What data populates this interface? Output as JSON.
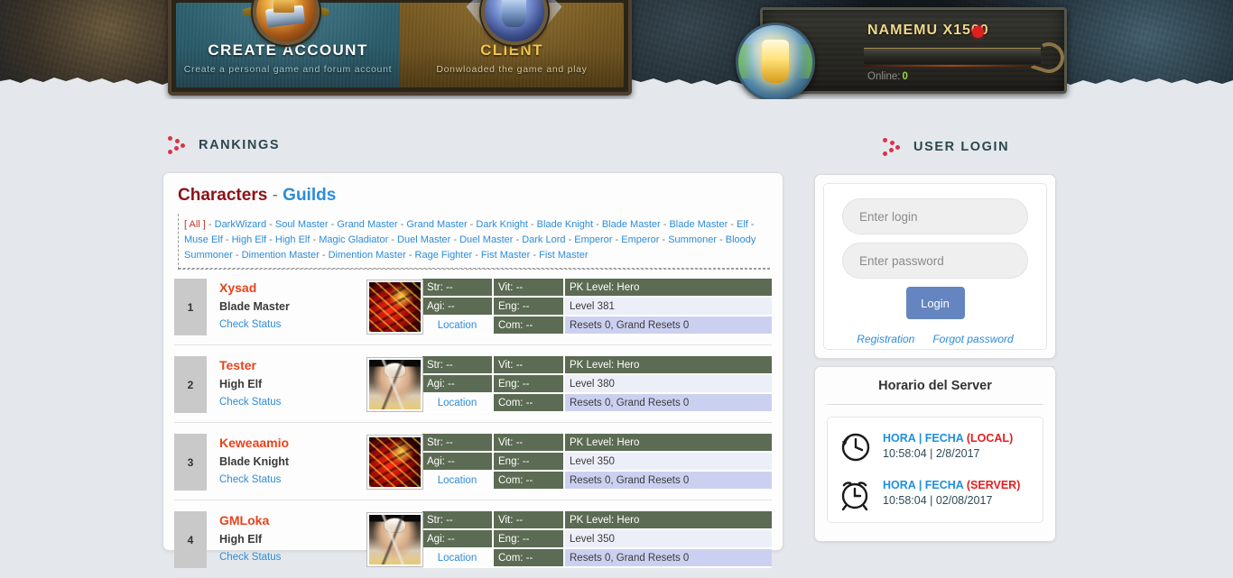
{
  "header": {
    "nav": [
      {
        "title": "CREATE ACCOUNT",
        "subtitle": "Create a personal game and forum account",
        "icon": "book-medal-icon"
      },
      {
        "title": "CLIENT",
        "subtitle": "Donwloaded the game and play",
        "icon": "armor-medal-icon"
      }
    ],
    "server": {
      "name": "NAMEMU X1500",
      "status_color": "#e02020",
      "online_label": "Online:",
      "online_count": "0"
    }
  },
  "rankings": {
    "section_title": "RANKINGS",
    "tabs": {
      "characters": "Characters",
      "separator": "-",
      "guilds": "Guilds"
    },
    "class_filters": [
      "[ All ]",
      "DarkWizard",
      "Soul Master",
      "Grand Master",
      "Grand Master",
      "Dark Knight",
      "Blade Knight",
      "Blade Master",
      "Blade Master",
      "Elf",
      "Muse Elf",
      "High Elf",
      "High Elf",
      "Magic Gladiator",
      "Duel Master",
      "Duel Master",
      "Dark Lord",
      "Emperor",
      "Emperor",
      "Summoner",
      "Bloody Summoner",
      "Dimention Master",
      "Dimention Master",
      "Rage Fighter",
      "Fist Master",
      "Fist Master"
    ],
    "status_link": "Check Status",
    "location_link": "Location",
    "rows": [
      {
        "rank": "1",
        "name": "Xysad",
        "class": "Blade Master",
        "portrait": "bm",
        "str": "Str: --",
        "vit": "Vit: --",
        "agi": "Agi: --",
        "eng": "Eng: --",
        "com": "Com: --",
        "pk": "PK Level: Hero",
        "level": "Level 381",
        "resets": "Resets 0, Grand Resets 0"
      },
      {
        "rank": "2",
        "name": "Tester",
        "class": "High Elf",
        "portrait": "he",
        "str": "Str: --",
        "vit": "Vit: --",
        "agi": "Agi: --",
        "eng": "Eng: --",
        "com": "Com: --",
        "pk": "PK Level: Hero",
        "level": "Level 380",
        "resets": "Resets 0, Grand Resets 0"
      },
      {
        "rank": "3",
        "name": "Keweaamio",
        "class": "Blade Knight",
        "portrait": "bm",
        "str": "Str: --",
        "vit": "Vit: --",
        "agi": "Agi: --",
        "eng": "Eng: --",
        "com": "Com: --",
        "pk": "PK Level: Hero",
        "level": "Level 350",
        "resets": "Resets 0, Grand Resets 0"
      },
      {
        "rank": "4",
        "name": "GMLoka",
        "class": "High Elf",
        "portrait": "he",
        "str": "Str: --",
        "vit": "Vit: --",
        "agi": "Agi: --",
        "eng": "Eng: --",
        "com": "Com: --",
        "pk": "PK Level: Hero",
        "level": "Level 350",
        "resets": "Resets 0, Grand Resets 0"
      }
    ]
  },
  "user_login": {
    "section_title": "USER LOGIN",
    "login_placeholder": "Enter login",
    "login_value": "",
    "password_placeholder": "Enter password",
    "password_value": "",
    "submit_label": "Login",
    "registration_link": "Registration",
    "forgot_link": "Forgot password"
  },
  "server_time": {
    "title": "Horario del Server",
    "entries": [
      {
        "icon": "clock-icon",
        "label_main": "HORA | FECHA ",
        "label_scope": "(LOCAL)",
        "value": "10:58:04 | 2/8/2017"
      },
      {
        "icon": "alarm-clock-icon",
        "label_main": "HORA | FECHA ",
        "label_scope": "(SERVER)",
        "value": "10:58:04 | 02/08/2017"
      }
    ]
  },
  "colors": {
    "page_background": "#e4e8ec",
    "accent_red": "#d8344a",
    "link_blue": "#2e8bd8",
    "name_orange": "#e8431c",
    "stat_cell": "#5c6b53",
    "level_cell": "#eceef8",
    "reset_cell": "#ccd0f0",
    "login_button": "#6485bf"
  }
}
